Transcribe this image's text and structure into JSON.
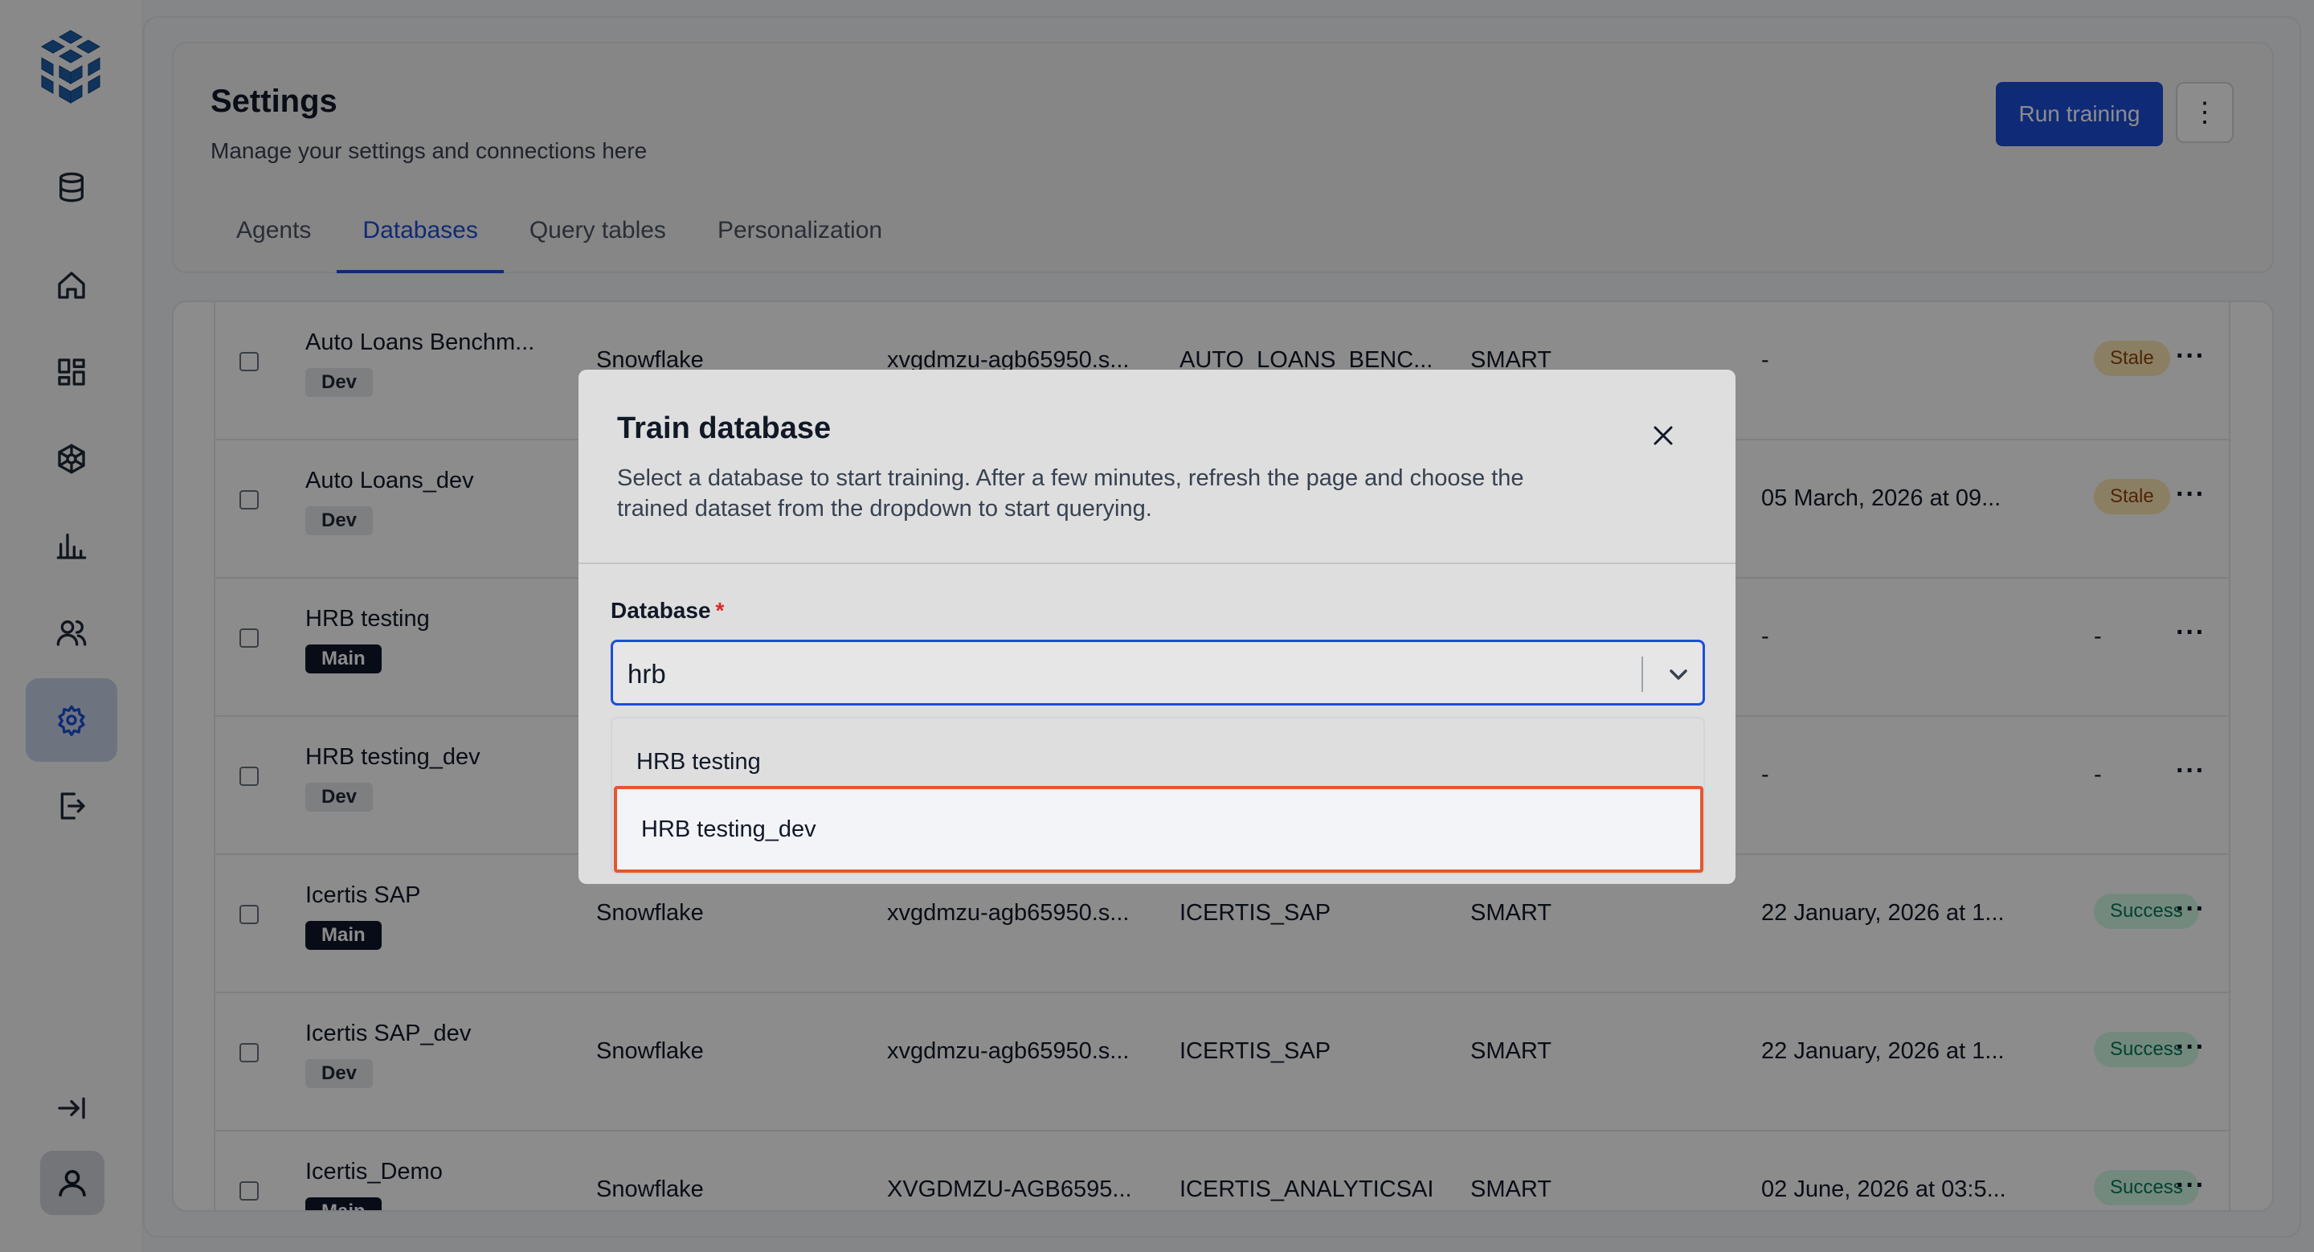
{
  "header": {
    "title": "Settings",
    "subtitle": "Manage your settings and connections here",
    "run_label": "Run training",
    "more_label": "⋮"
  },
  "tabs": [
    {
      "label": "Agents"
    },
    {
      "label": "Databases"
    },
    {
      "label": "Query tables"
    },
    {
      "label": "Personalization"
    }
  ],
  "rows": [
    {
      "name": "Auto Loans Benchm...",
      "tag": "Dev",
      "source": "Snowflake",
      "host": "xvgdmzu-agb65950.s...",
      "schema": "AUTO_LOANS_BENC...",
      "mode": "SMART",
      "trained": "-",
      "status": "Stale"
    },
    {
      "name": "Auto Loans_dev",
      "tag": "Dev",
      "source": "",
      "host": "",
      "schema": "",
      "mode": "",
      "trained": "05 March, 2026 at 09...",
      "status": "Stale"
    },
    {
      "name": "HRB testing",
      "tag": "Main",
      "source": "",
      "host": "",
      "schema": "",
      "mode": "",
      "trained": "-",
      "status": "-"
    },
    {
      "name": "HRB testing_dev",
      "tag": "Dev",
      "source": "",
      "host": "",
      "schema": "",
      "mode": "",
      "trained": "-",
      "status": "-"
    },
    {
      "name": "Icertis SAP",
      "tag": "Main",
      "source": "Snowflake",
      "host": "xvgdmzu-agb65950.s...",
      "schema": "ICERTIS_SAP",
      "mode": "SMART",
      "trained": "22 January, 2026 at 1...",
      "status": "Success"
    },
    {
      "name": "Icertis SAP_dev",
      "tag": "Dev",
      "source": "Snowflake",
      "host": "xvgdmzu-agb65950.s...",
      "schema": "ICERTIS_SAP",
      "mode": "SMART",
      "trained": "22 January, 2026 at 1...",
      "status": "Success"
    },
    {
      "name": "Icertis_Demo",
      "tag": "Main",
      "source": "Snowflake",
      "host": "XVGDMZU-AGB6595...",
      "schema": "ICERTIS_ANALYTICSAI",
      "mode": "SMART",
      "trained": "02 June, 2026 at 03:5...",
      "status": "Success"
    }
  ],
  "row_more_label": "···",
  "modal": {
    "title": "Train database",
    "description": "Select a database to start training. After a few minutes, refresh the page and choose the trained dataset from the dropdown to start querying.",
    "field_label": "Database",
    "required_mark": "*",
    "input_value": "hrb",
    "options": [
      {
        "label": "HRB testing"
      },
      {
        "label": "HRB testing_dev"
      }
    ]
  },
  "colors": {
    "accent": "#1d4ed8",
    "highlight_border": "#e4572e",
    "stale_bg": "#fbe7b4",
    "success_bg": "#d1fae5"
  },
  "icons": [
    "logo-cubes",
    "database-icon",
    "home-icon",
    "dashboard-icon",
    "model-icon",
    "chart-icon",
    "users-icon",
    "settings-icon",
    "logout-icon",
    "collapse-icon",
    "user-icon"
  ]
}
